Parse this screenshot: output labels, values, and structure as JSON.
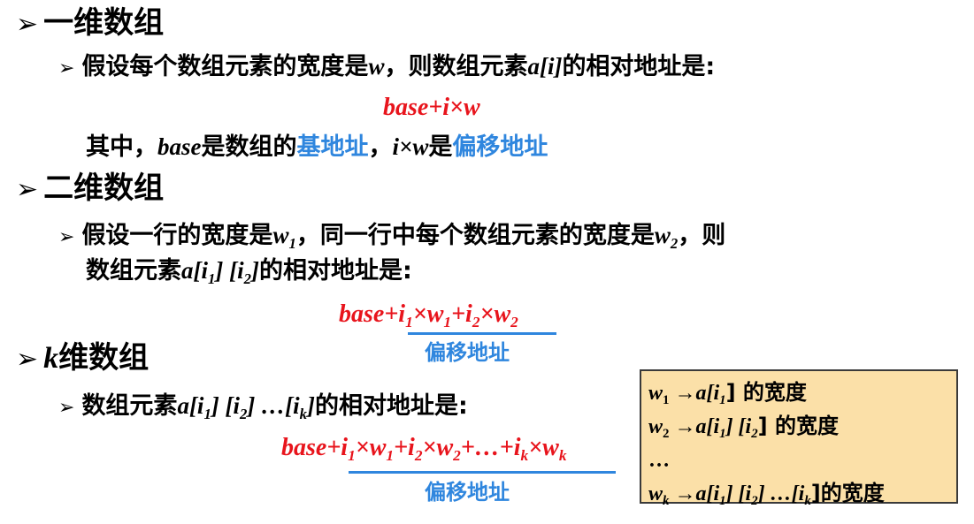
{
  "sections": [
    {
      "heading": "一维数组",
      "bullet_text": "假设每个数组元素的宽度是",
      "bullet_var": "w",
      "bullet_text2": "，则数组元素",
      "bullet_elem": "a[i]",
      "bullet_text3": "的相对地址是:",
      "formula": "base+i×w",
      "note_prefix": "其中，",
      "note_base": "base",
      "note_mid": "是数组的",
      "note_base_addr": "基地址",
      "note_sep": "，",
      "note_iw": "i×w",
      "note_is": "是",
      "note_offset": "偏移地址"
    },
    {
      "heading": "二维数组",
      "line1_a": "假设一行的宽度是",
      "line1_w1": "w",
      "line1_b": "，同一行中每个数组元素的宽度是",
      "line1_w2": "w",
      "line1_c": "，则",
      "line2_a": "数组元素",
      "line2_elem": "a[i",
      "line2_mid": "] [i",
      "line2_end": "]",
      "line2_b": "的相对地址是:",
      "formula_base": "base+",
      "formula_i1": "i",
      "formula_x1": "×w",
      "formula_plus": "+i",
      "formula_x2": "×w",
      "offset_label": "偏移地址"
    },
    {
      "heading_var": "k",
      "heading": "维数组",
      "line_a": "数组元素",
      "line_elem": "a[i",
      "line_mid": "] [i",
      "line_dots": "] …[i",
      "line_end": "]",
      "line_b": "的相对地址是:",
      "formula_base": "base+",
      "formula_i1": "i",
      "formula_x1": "×w",
      "formula_plus2": "+i",
      "formula_x2": "×w",
      "formula_dots": "+…+i",
      "formula_xk": "×w",
      "offset_label": "偏移地址"
    }
  ],
  "subscripts": {
    "one": "1",
    "two": "2",
    "k": "k"
  },
  "box": {
    "rows": [
      {
        "w": "w",
        "sub": "1",
        "arrow": " →a[i",
        "rest": "] 的宽度"
      },
      {
        "w": "w",
        "sub": "2",
        "arrow": " →a[i",
        "rest": "] 的宽度"
      },
      {
        "dots": "…"
      },
      {
        "w": "w",
        "sub": "k",
        "arrow": " →a[i",
        "rest": "]的宽度"
      }
    ],
    "row2_mid": "] [i",
    "row4_mid": "] [i",
    "row4_dots": "] …[i"
  },
  "colors": {
    "formula": "#e8141c",
    "highlight": "#2f86de",
    "box_bg": "#fbe0a8"
  }
}
